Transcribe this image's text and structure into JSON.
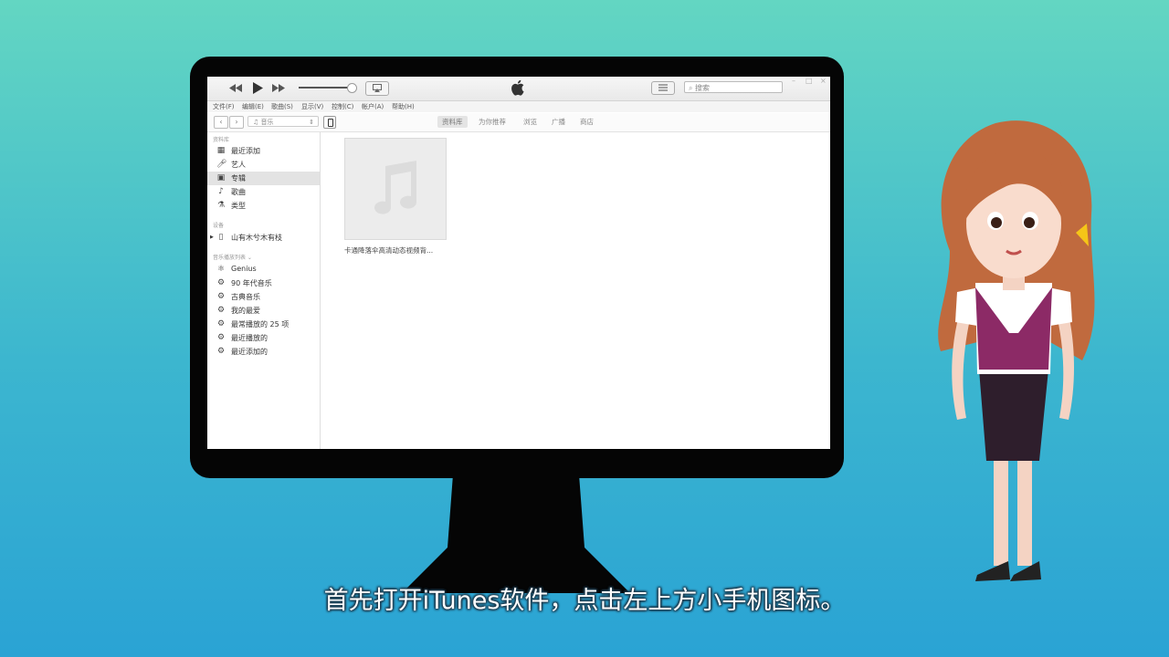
{
  "colors": {
    "background_top": "#63d6c2",
    "background_bottom": "#2aa3d4",
    "monitor": "#050505"
  },
  "toolbar": {
    "search_placeholder": "搜索",
    "icons": [
      "rewind-icon",
      "play-icon",
      "fast-forward-icon",
      "airplay-icon",
      "apple-logo",
      "list-view-icon",
      "search-icon"
    ]
  },
  "menu": [
    "文件(F)",
    "编辑(E)",
    "歌曲(S)",
    "显示(V)",
    "控制(C)",
    "帐户(A)",
    "帮助(H)"
  ],
  "nav": {
    "back": "‹",
    "forward": "›",
    "media_selector": "音乐",
    "tabs": [
      "资料库",
      "为你推荐",
      "浏览",
      "广播",
      "商店"
    ],
    "active_tab": "资料库"
  },
  "sidebar": {
    "library_heading": "资料库",
    "library_items": [
      {
        "label": "最近添加",
        "icon": "calendar-icon"
      },
      {
        "label": "艺人",
        "icon": "microphone-icon"
      },
      {
        "label": "专辑",
        "icon": "album-icon",
        "selected": true
      },
      {
        "label": "歌曲",
        "icon": "music-note-icon"
      },
      {
        "label": "类型",
        "icon": "genre-icon"
      }
    ],
    "devices_heading": "设备",
    "device_name": "山有木兮木有枝",
    "playlists_heading": "音乐播放列表 ⌄",
    "playlist_items": [
      "Genius",
      "90 年代音乐",
      "古典音乐",
      "我的最爱",
      "最常播放的 25 项",
      "最近播放的",
      "最近添加的"
    ]
  },
  "main": {
    "album_caption": "卡通降落伞高清动态视频背..."
  },
  "subtitle": "首先打开iTunes软件，点击左上方小手机图标。"
}
